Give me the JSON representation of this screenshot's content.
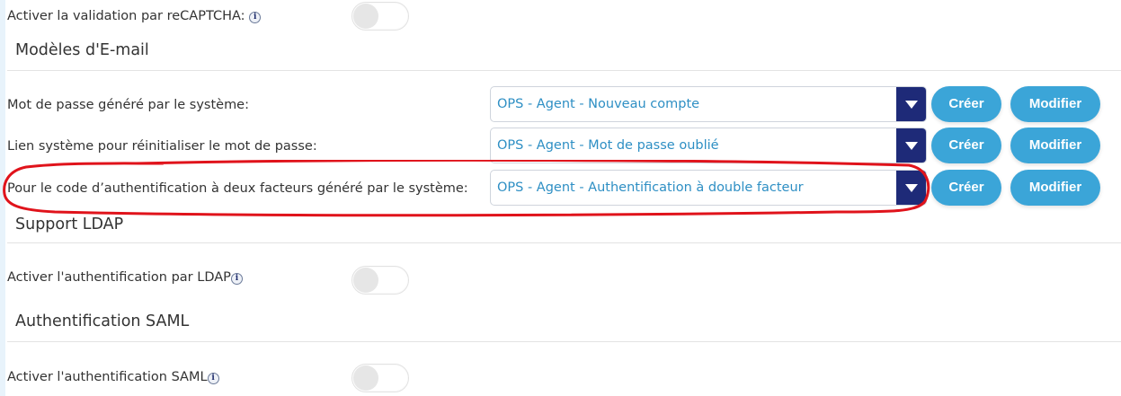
{
  "recaptcha": {
    "label": "Activer la validation par reCAPTCHA:",
    "enabled": false
  },
  "email_templates": {
    "title": "Modèles d'E-mail",
    "create_label": "Créer",
    "modify_label": "Modifier",
    "rows": [
      {
        "label": "Mot de passe généré par le système:",
        "value": "OPS - Agent - Nouveau compte"
      },
      {
        "label": "Lien système pour réinitialiser le mot de passe:",
        "value": "OPS - Agent - Mot de passe oublié"
      },
      {
        "label": "Pour le code d’authentification à deux facteurs généré par le système:",
        "value": "OPS - Agent - Authentification à double facteur"
      }
    ]
  },
  "ldap": {
    "title": "Support LDAP",
    "label": "Activer l'authentification par LDAP",
    "enabled": false
  },
  "saml": {
    "title": "Authentification SAML",
    "label": "Activer l'authentification SAML",
    "enabled": false
  },
  "colors": {
    "accent": "#3ba5d8",
    "select_arrow": "#1e2a78",
    "value_text": "#2e8fc4",
    "highlight": "#e0131b"
  },
  "icons": {
    "info": "info-icon",
    "dropdown": "dropdown-arrow-icon"
  }
}
